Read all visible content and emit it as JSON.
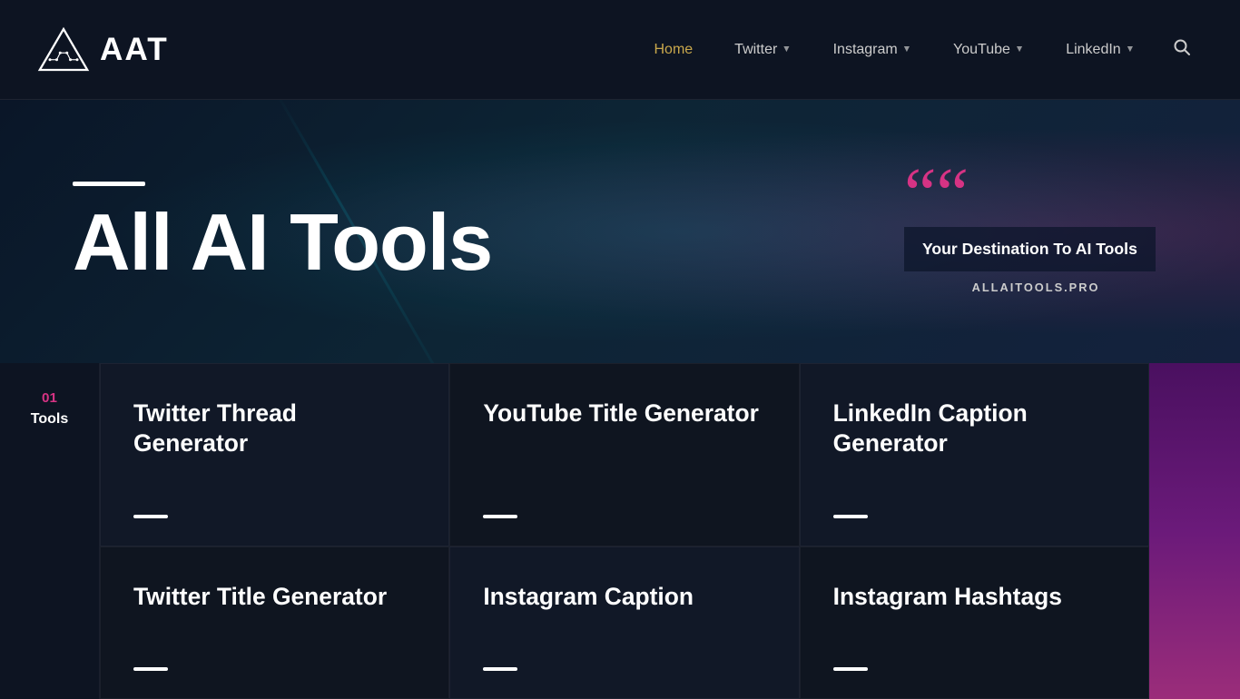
{
  "header": {
    "logo_text": "AAT",
    "nav_items": [
      {
        "label": "Home",
        "active": true,
        "has_dropdown": false
      },
      {
        "label": "Twitter",
        "active": false,
        "has_dropdown": true
      },
      {
        "label": "Instagram",
        "active": false,
        "has_dropdown": true
      },
      {
        "label": "YouTube",
        "active": false,
        "has_dropdown": true
      },
      {
        "label": "LinkedIn",
        "active": false,
        "has_dropdown": true
      }
    ]
  },
  "hero": {
    "line_decoration": "",
    "title": "All AI Tools",
    "quote": {
      "marks": "““",
      "text": "Your Destination To AI Tools",
      "domain": "ALLAITOOLS.PRO"
    }
  },
  "content": {
    "sidebar_number": "01",
    "sidebar_label": "Tools",
    "tool_cards": [
      {
        "title": "Twitter Thread Generator"
      },
      {
        "title": "YouTube Title Generator"
      },
      {
        "title": "LinkedIn Caption Generator"
      },
      {
        "title": "Twitter Title Generator"
      },
      {
        "title": "Instagram Caption"
      },
      {
        "title": "Instagram Hashtags"
      }
    ]
  }
}
